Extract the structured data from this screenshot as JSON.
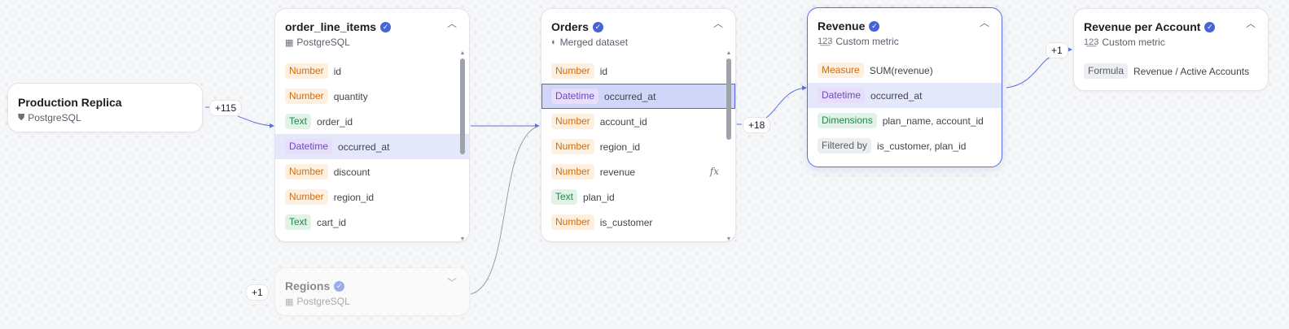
{
  "nodes": {
    "production_replica": {
      "title": "Production Replica",
      "subtitle": "PostgreSQL",
      "icon": "database-icon"
    },
    "order_line_items": {
      "title": "order_line_items",
      "subtitle": "PostgreSQL",
      "icon": "table-icon",
      "fields": [
        {
          "type": "Number",
          "name": "id"
        },
        {
          "type": "Number",
          "name": "quantity"
        },
        {
          "type": "Text",
          "name": "order_id"
        },
        {
          "type": "Datetime",
          "name": "occurred_at"
        },
        {
          "type": "Number",
          "name": "discount"
        },
        {
          "type": "Number",
          "name": "region_id"
        },
        {
          "type": "Text",
          "name": "cart_id"
        }
      ]
    },
    "orders": {
      "title": "Orders",
      "subtitle": "Merged dataset",
      "icon": "merge-icon",
      "fields": [
        {
          "type": "Number",
          "name": "id"
        },
        {
          "type": "Datetime",
          "name": "occurred_at"
        },
        {
          "type": "Number",
          "name": "account_id"
        },
        {
          "type": "Number",
          "name": "region_id"
        },
        {
          "type": "Number",
          "name": "revenue",
          "formula_icon": "fx"
        },
        {
          "type": "Text",
          "name": "plan_id"
        },
        {
          "type": "Number",
          "name": "is_customer"
        }
      ]
    },
    "revenue": {
      "title": "Revenue",
      "subtitle": "Custom metric",
      "icon": "metric-icon",
      "subtitle_glyph": "1̲2̲3",
      "rows": [
        {
          "label": "Measure",
          "value": "SUM(revenue)"
        },
        {
          "label": "Datetime",
          "value": "occurred_at"
        },
        {
          "label": "Dimensions",
          "value": "plan_name, account_id"
        },
        {
          "label": "Filtered by",
          "value": "is_customer, plan_id"
        }
      ]
    },
    "revenue_per_account": {
      "title": "Revenue per Account",
      "subtitle": "Custom metric",
      "icon": "metric-icon",
      "subtitle_glyph": "1̲2̲3",
      "rows": [
        {
          "label": "Formula",
          "value": "Revenue / Active Accounts"
        }
      ]
    },
    "regions": {
      "title": "Regions",
      "subtitle": "PostgreSQL",
      "icon": "table-icon"
    }
  },
  "badges": {
    "replica_out": "+115",
    "orders_out": "+18",
    "revenue_out": "+1",
    "regions_in": "+1"
  },
  "colors": {
    "accent": "#4763d8",
    "wire": "#5a6ee6",
    "wire_faded": "#9a9ea8"
  }
}
